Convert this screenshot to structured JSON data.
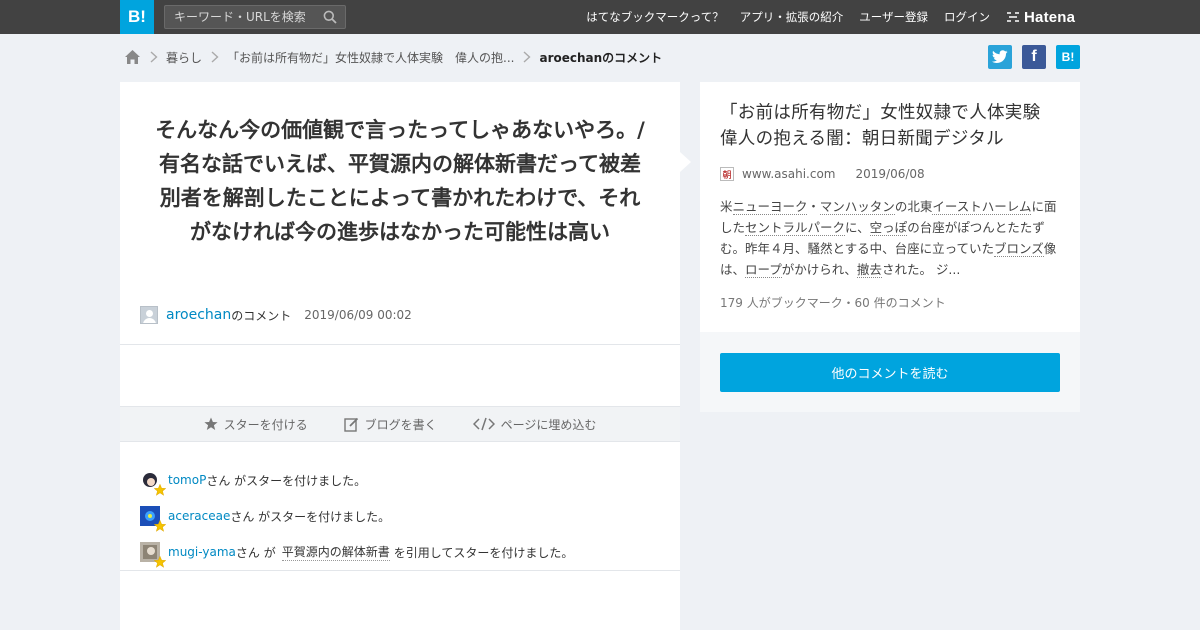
{
  "header": {
    "logo": "B!",
    "search_placeholder": "キーワード・URLを検索",
    "nav": [
      "はてなブックマークって？",
      "アプリ・拡張の紹介",
      "ユーザー登録",
      "ログイン"
    ],
    "brand": "Hatena"
  },
  "breadcrumb": {
    "items": [
      "暮らし",
      "「お前は所有物だ」女性奴隷で人体実験　偉人の抱...",
      "aroechanのコメント"
    ]
  },
  "social": {
    "twitter": "twitter",
    "facebook": "f",
    "hatena": "B!"
  },
  "comment": {
    "text": "そんなん今の価値観で言ったってしゃあないやろ。/有名な話でいえば、平賀源内の解体新書だって被差別者を解剖したことによって書かれたわけで、それがなければ今の進歩はなかった可能性は高い",
    "user": "aroechan",
    "user_suffix": "のコメント",
    "timestamp": "2019/06/09 00:02"
  },
  "actions": {
    "star": "スターを付ける",
    "blog": "ブログを書く",
    "embed": "ページに埋め込む"
  },
  "stars": [
    {
      "user": "tomoP",
      "text": "さん がスターを付けました。"
    },
    {
      "user": "aceraceae",
      "text": "さん がスターを付けました。"
    },
    {
      "user": "mugi-yama",
      "text_before": "さん が",
      "quoted": "平賀源内の解体新書",
      "text_after": "を引用してスターを付けました。"
    }
  ],
  "entry": {
    "title": "「お前は所有物だ」女性奴隷で人体実験　偉人の抱える闇：朝日新聞デジタル",
    "favicon": "朝",
    "domain": "www.asahi.com",
    "date": "2019/06/08",
    "summary": {
      "s1": "米",
      "k1": "ニューヨーク",
      "s2": "・",
      "k2": "マンハッタン",
      "s3": "の北東",
      "k3": "イーストハーレム",
      "s4": "に面した",
      "k4": "セントラルパーク",
      "s5": "に、",
      "k5": "空っぽ",
      "s6": "の台座がぽつんとたたずむ。昨年４月、騒然とする中、台座に立っていた",
      "k6": "ブロンズ",
      "s7": "像は、",
      "k7": "ロープ",
      "s8": "がかけられ、",
      "k8": "撤去",
      "s9": "された。 ジ..."
    },
    "bookmark_count": "179 人がブックマーク・60 件のコメント"
  },
  "read_button": "他のコメントを読む",
  "colors": {
    "header_bg": "#424242",
    "brand_blue": "#00a4de",
    "link": "#0089c3",
    "twitter": "#2aa3d9",
    "facebook": "#3b5998",
    "star": "#f5c400"
  }
}
